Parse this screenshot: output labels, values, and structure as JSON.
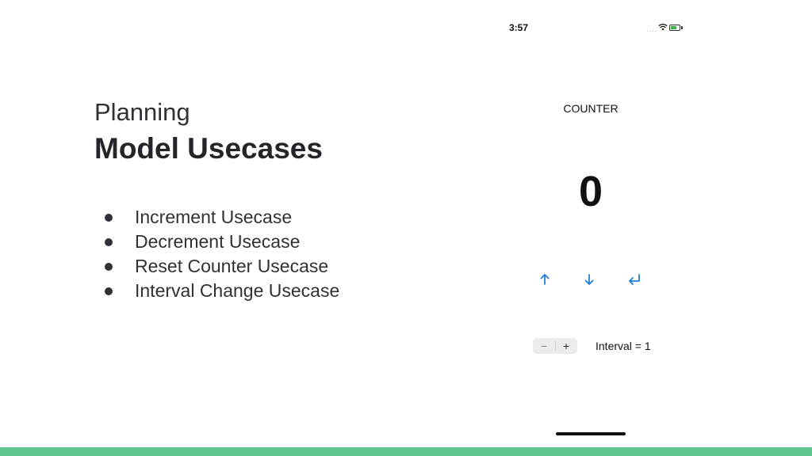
{
  "slide": {
    "subtitle": "Planning",
    "title": "Model Usecases",
    "bullets": [
      "Increment Usecase",
      "Decrement Usecase",
      "Reset Counter Usecase",
      "Interval Change Usecase"
    ]
  },
  "phone": {
    "status": {
      "time": "3:57",
      "signal": "....",
      "icons": [
        "wifi-icon",
        "battery-icon"
      ],
      "battery_color": "#3bb54a"
    },
    "counter_label": "COUNTER",
    "counter_value": "0",
    "actions": [
      {
        "name": "increment",
        "icon": "arrow-up-icon"
      },
      {
        "name": "decrement",
        "icon": "arrow-down-icon"
      },
      {
        "name": "reset",
        "icon": "return-icon"
      }
    ],
    "accent_color": "#1e7fd6",
    "stepper": {
      "minus": "−",
      "plus": "+"
    },
    "interval_text": "Interval = 1"
  },
  "theme": {
    "bottom_bar_color": "#5ec78e"
  }
}
